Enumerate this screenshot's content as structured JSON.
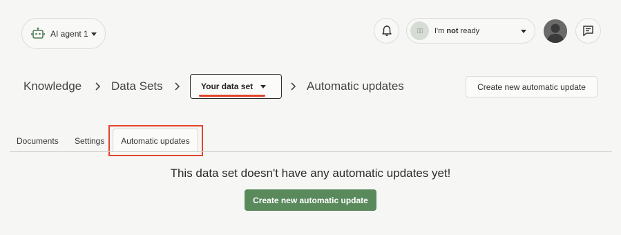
{
  "header": {
    "agent_label": "AI agent 1",
    "status_prefix": "I'm ",
    "status_bold": "not",
    "status_suffix": " ready",
    "status_dot_text": "▯▯"
  },
  "breadcrumb": {
    "knowledge": "Knowledge",
    "data_sets": "Data Sets",
    "dataset_select": "Your data set",
    "current": "Automatic updates"
  },
  "actions": {
    "create_top": "Create new automatic update",
    "create_main": "Create new automatic update"
  },
  "tabs": [
    {
      "label": "Documents"
    },
    {
      "label": "Settings"
    },
    {
      "label": "Automatic updates",
      "active": true
    }
  ],
  "empty_state": {
    "message": "This data set doesn't have any automatic updates yet!"
  },
  "colors": {
    "accent_green": "#5a8a5c",
    "highlight_red": "#e0452a"
  },
  "icons": [
    "robot-icon",
    "bell-icon",
    "avatar",
    "chat-icon",
    "chevron-right-icon",
    "caret-down-icon"
  ]
}
